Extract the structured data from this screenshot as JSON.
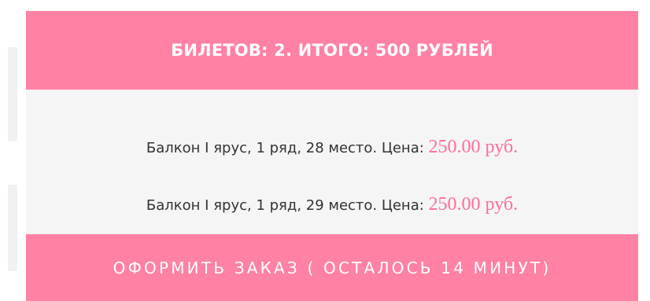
{
  "summary": {
    "title": "БИЛЕТОВ: 2. ИТОГО: 500 РУБЛЕЙ"
  },
  "tickets": [
    {
      "description": "Балкон I ярус, 1 ряд, 28 место. Цена: ",
      "price": "250.00 руб."
    },
    {
      "description": "Балкон I ярус, 1 ряд, 29 место. Цена: ",
      "price": "250.00 руб."
    }
  ],
  "checkout": {
    "label": "ОФОРМИТЬ ЗАКАЗ ( ОСТАЛОСЬ 14 МИНУТ)"
  },
  "colors": {
    "accent": "#ff81a4",
    "price": "#ff6f97",
    "panel_background": "#f5f5f6",
    "text": "#333333"
  }
}
